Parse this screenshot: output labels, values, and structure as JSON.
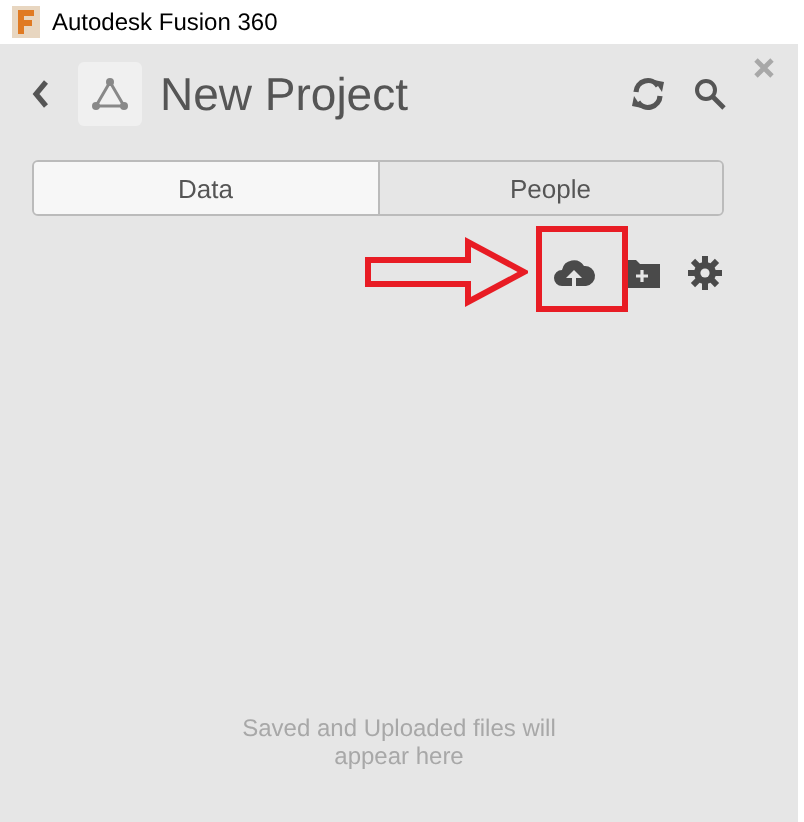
{
  "window": {
    "title": "Autodesk Fusion 360"
  },
  "project": {
    "title": "New Project"
  },
  "tabs": [
    {
      "label": "Data",
      "selected": true
    },
    {
      "label": "People",
      "selected": false
    }
  ],
  "empty_message": "Saved and Uploaded files will appear here"
}
